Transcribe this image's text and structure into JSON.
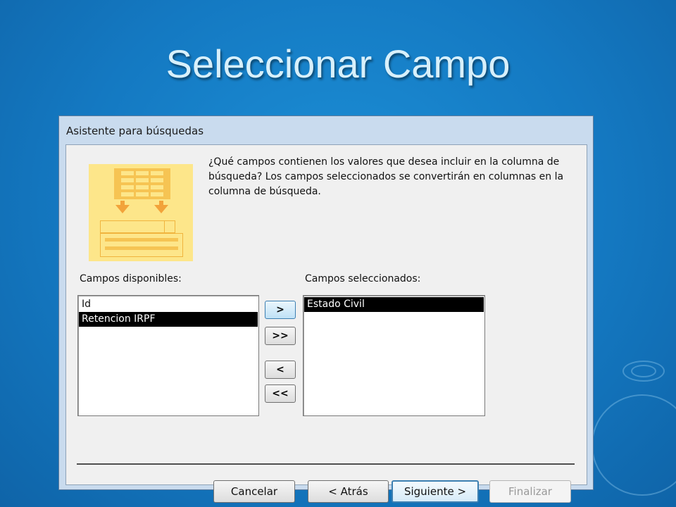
{
  "slide": {
    "title": "Seleccionar Campo"
  },
  "dialog": {
    "title": "Asistente para búsquedas",
    "question": "¿Qué campos contienen los valores que desea incluir en la columna de búsqueda? Los campos seleccionados se convertirán en columnas en la columna de búsqueda.",
    "available": {
      "label": "Campos disponibles:",
      "items": [
        "Id",
        "Retencion IRPF"
      ],
      "selected_item": "Retencion IRPF"
    },
    "selected": {
      "label": "Campos seleccionados:",
      "items": [
        "Estado Civil"
      ]
    },
    "move_buttons": {
      "add_one": ">",
      "add_all": ">>",
      "remove_one": "<",
      "remove_all": "<<"
    },
    "buttons": {
      "cancel": "Cancelar",
      "back": "< Atrás",
      "next": "Siguiente >",
      "finish": "Finalizar"
    }
  }
}
